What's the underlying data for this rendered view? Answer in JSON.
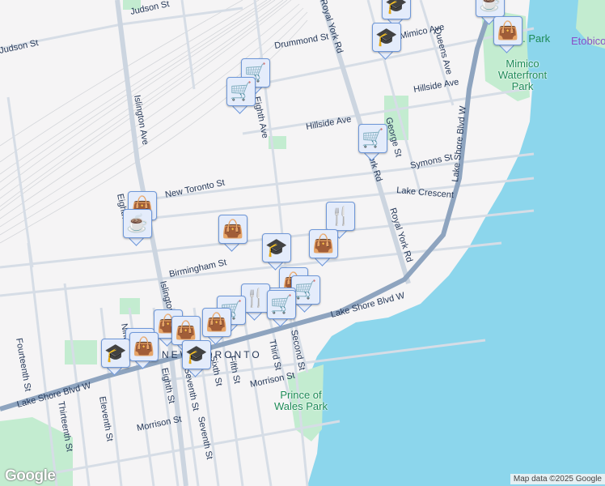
{
  "map": {
    "streets": [
      "Judson St",
      "Judson St",
      "Drummond St",
      "Islington Ave",
      "New Toronto St",
      "Hillside Ave",
      "Hillside Ave",
      "Symons St",
      "Lake Crescent",
      "George St",
      "Queens Ave",
      "Royal York Rd",
      "York Rd",
      "Royal York Rd",
      "Lake Shore Blvd W",
      "Lake Shore Blvd W",
      "Lake Shore Blvd W",
      "Birmingham St",
      "Islington Ave",
      "Eighth St",
      "Eighth St",
      "Seventh St",
      "Seventh St",
      "Sixth St",
      "Fifth St",
      "Third St",
      "Second St",
      "Morrison St",
      "Morrison St",
      "Fourteenth St",
      "Thirteenth St",
      "Eleventh St",
      "Ninth St",
      "Eighth Ave",
      "Mimico Ave"
    ],
    "area_labels": [
      "NEW TORONTO",
      "Etobicoke"
    ],
    "parks": [
      "Prince of Wales Park",
      "Mimico Waterfront Park",
      "Amos Waddington Park"
    ],
    "colors": {
      "water": "#8cd6ec",
      "land": "#f5f4f5",
      "park": "#c3ecd0",
      "major_road": "#8ea4bf",
      "road": "#d6dde6",
      "marker_icon": "#003f66"
    }
  },
  "markers": [
    "education-icon",
    "education-icon",
    "coffee-icon",
    "shopping-bag-icon",
    "grocery-cart-icon",
    "grocery-cart-icon",
    "grocery-cart-icon",
    "shopping-bag-icon",
    "coffee-icon",
    "shopping-bag-icon",
    "restaurant-icon",
    "shopping-bag-icon",
    "education-icon",
    "shopping-bag-icon",
    "grocery-cart-icon",
    "grocery-cart-icon",
    "restaurant-icon",
    "grocery-cart-icon",
    "grocery-cart-icon",
    "shopping-bag-icon",
    "shopping-bag-icon",
    "shopping-bag-icon",
    "shopping-bag-icon",
    "education-icon",
    "shopping-bag-icon",
    "education-icon"
  ],
  "footer": {
    "logo": "Google",
    "attribution": "Map data ©2025 Google"
  }
}
